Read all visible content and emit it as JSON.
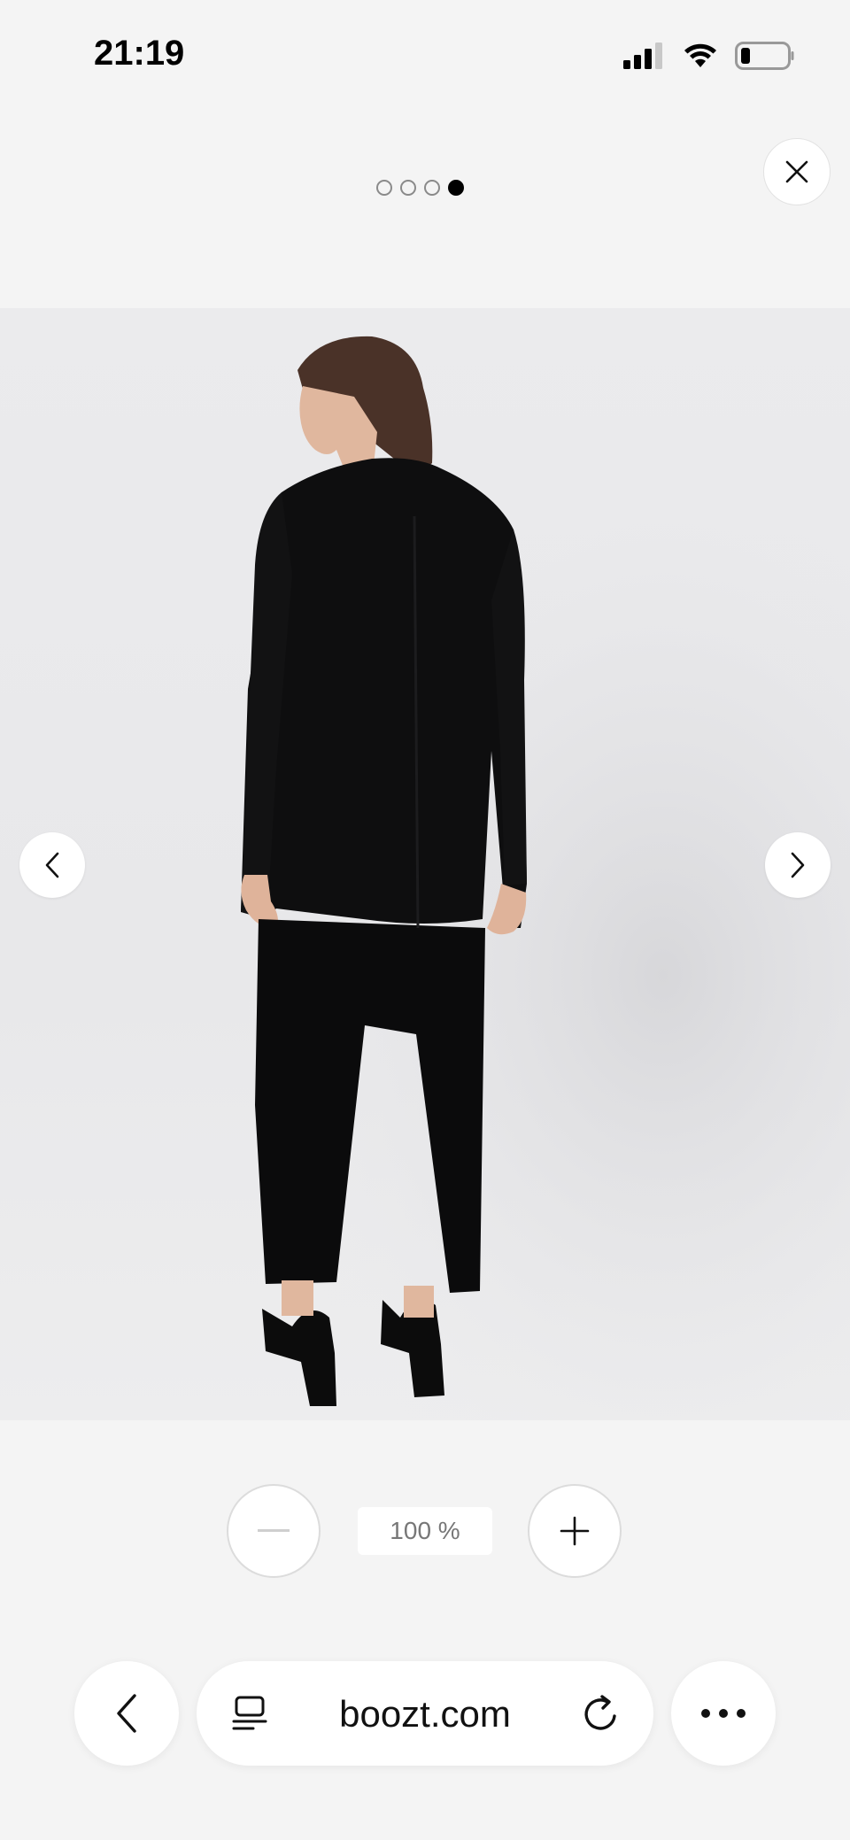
{
  "status_bar": {
    "time": "21:19",
    "icons": [
      "cellular-signal-icon",
      "wifi-icon",
      "battery-icon"
    ]
  },
  "gallery": {
    "dot_count": 4,
    "active_index": 3,
    "close_icon": "close-icon",
    "prev_icon": "chevron-left-icon",
    "next_icon": "chevron-right-icon",
    "image_description": "product-photo-black-suit"
  },
  "zoom": {
    "level": "100 %",
    "minus_icon": "minus-icon",
    "plus_icon": "plus-icon"
  },
  "browser": {
    "url": "boozt.com",
    "back_icon": "chevron-left-icon",
    "tabs_icon": "tab-view-icon",
    "reload_icon": "reload-icon",
    "more_icon": "more-icon"
  },
  "colors": {
    "background": "#f4f4f4",
    "photo_background": "#ebebed",
    "suit": "#0d0d0d"
  }
}
